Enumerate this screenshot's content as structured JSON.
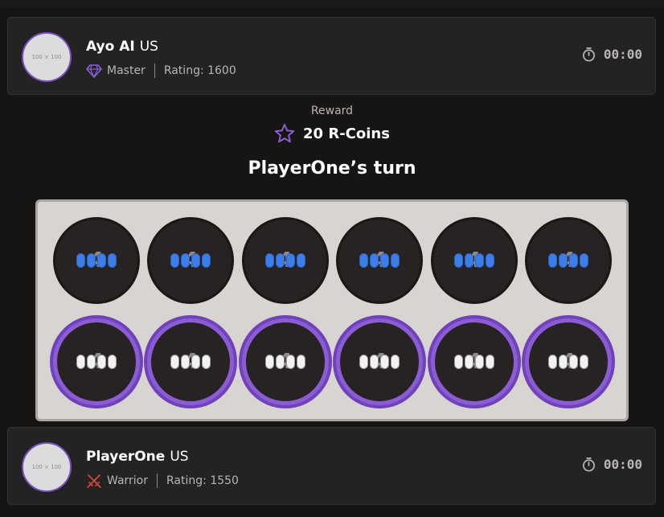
{
  "opponent": {
    "avatar_text": "100 × 100",
    "name": "Ayo AI",
    "country": "US",
    "rank": "Master",
    "rating": "Rating: 1600",
    "timer": "00:00",
    "rank_icon": "diamond-icon"
  },
  "reward": {
    "label": "Reward",
    "amount": "20 R-Coins",
    "icon": "star-icon"
  },
  "turn_text": "PlayerOne’s turn",
  "board": {
    "top_row": [
      {
        "seeds": 4,
        "color": "blue"
      },
      {
        "seeds": 4,
        "color": "blue"
      },
      {
        "seeds": 4,
        "color": "blue"
      },
      {
        "seeds": 4,
        "color": "blue"
      },
      {
        "seeds": 4,
        "color": "blue"
      },
      {
        "seeds": 4,
        "color": "blue"
      }
    ],
    "bottom_row": [
      {
        "seeds": 4,
        "color": "white"
      },
      {
        "seeds": 4,
        "color": "white"
      },
      {
        "seeds": 4,
        "color": "white"
      },
      {
        "seeds": 4,
        "color": "white"
      },
      {
        "seeds": 4,
        "color": "white"
      },
      {
        "seeds": 4,
        "color": "white"
      }
    ],
    "colors": {
      "active_ring": "#8b5cd6",
      "blue_seed": "#3d7ee8",
      "white_seed": "#f2f2f2"
    }
  },
  "player": {
    "avatar_text": "100 × 100",
    "name": "PlayerOne",
    "country": "US",
    "rank": "Warrior",
    "rating": "Rating: 1550",
    "timer": "00:00",
    "rank_icon": "crossed-swords-icon"
  }
}
